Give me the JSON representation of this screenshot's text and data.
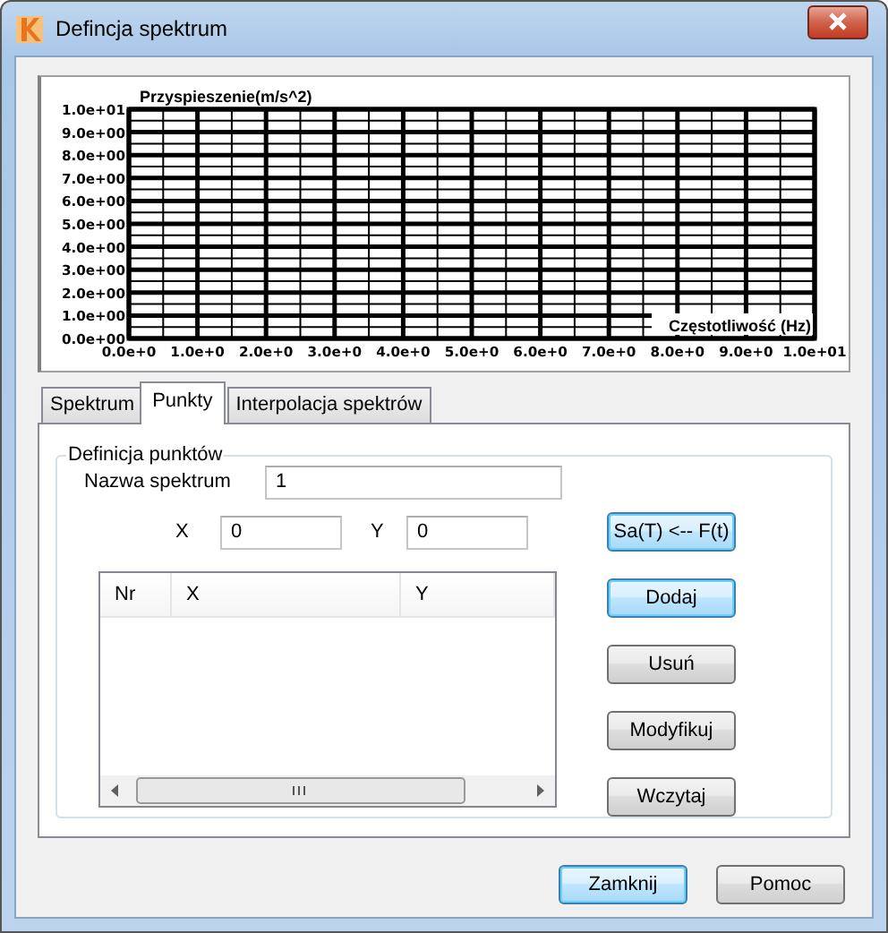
{
  "window": {
    "title": "Defincja spektrum"
  },
  "chart": {
    "chart_data": {
      "type": "line",
      "grid": true,
      "ylabel": "Przyspieszenie(m/s^2)",
      "xlabel": "Częstotliwość (Hz)",
      "xlim": [
        0,
        10
      ],
      "ylim": [
        0,
        10
      ],
      "xticks": [
        {
          "value": 0,
          "label": "0.0e+0"
        },
        {
          "value": 1,
          "label": "1.0e+0"
        },
        {
          "value": 2,
          "label": "2.0e+0"
        },
        {
          "value": 3,
          "label": "3.0e+0"
        },
        {
          "value": 4,
          "label": "4.0e+0"
        },
        {
          "value": 5,
          "label": "5.0e+0"
        },
        {
          "value": 6,
          "label": "6.0e+0"
        },
        {
          "value": 7,
          "label": "7.0e+0"
        },
        {
          "value": 8,
          "label": "8.0e+0"
        },
        {
          "value": 9,
          "label": "9.0e+0"
        },
        {
          "value": 10,
          "label": "1.0e+01"
        }
      ],
      "yticks": [
        {
          "value": 0,
          "label": "0.0e+00"
        },
        {
          "value": 1,
          "label": "1.0e+00"
        },
        {
          "value": 2,
          "label": "2.0e+00"
        },
        {
          "value": 3,
          "label": "3.0e+00"
        },
        {
          "value": 4,
          "label": "4.0e+00"
        },
        {
          "value": 5,
          "label": "5.0e+00"
        },
        {
          "value": 6,
          "label": "6.0e+00"
        },
        {
          "value": 7,
          "label": "7.0e+00"
        },
        {
          "value": 8,
          "label": "8.0e+00"
        },
        {
          "value": 9,
          "label": "9.0e+00"
        },
        {
          "value": 10,
          "label": "1.0e+01"
        }
      ]
    }
  },
  "tabs": [
    {
      "label": "Spektrum",
      "selected": false
    },
    {
      "label": "Punkty",
      "selected": true
    },
    {
      "label": "Interpolacja spektrów",
      "selected": false
    }
  ],
  "group": {
    "title": "Definicja punktów",
    "name_label": "Nazwa spektrum",
    "name_value": "1",
    "x_label": "X",
    "x_value": "0",
    "y_label": "Y",
    "y_value": "0"
  },
  "table": {
    "columns": [
      "Nr",
      "X",
      "Y"
    ]
  },
  "side_buttons": [
    {
      "label": "Sa(T) <-- F(t)",
      "default": true
    },
    {
      "label": "Dodaj",
      "default": true
    },
    {
      "label": "Usuń",
      "default": false
    },
    {
      "label": "Modyfikuj",
      "default": false
    },
    {
      "label": "Wczytaj",
      "default": false
    }
  ],
  "footer_buttons": [
    {
      "label": "Zamknij",
      "default": true
    },
    {
      "label": "Pomoc",
      "default": false
    }
  ]
}
